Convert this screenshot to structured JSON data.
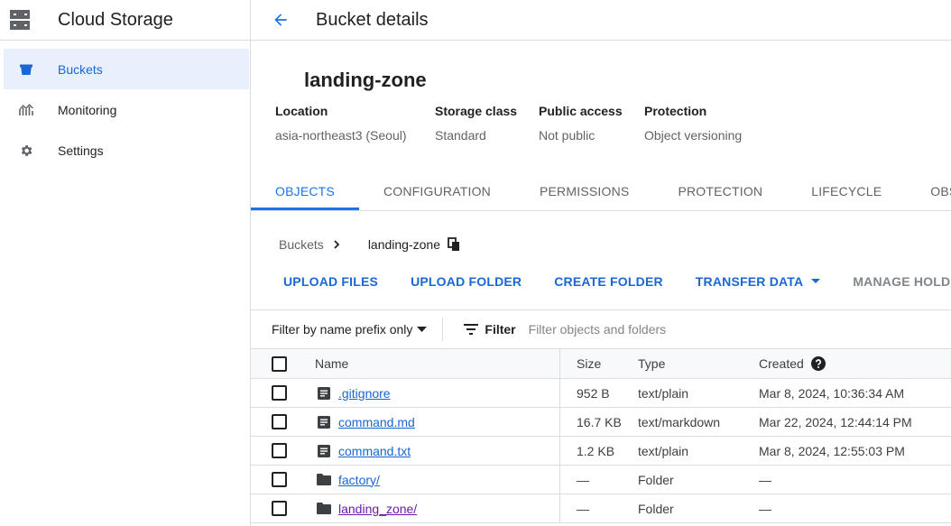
{
  "app": {
    "title": "Cloud Storage",
    "icon": "storage-icon"
  },
  "sidebar": {
    "items": [
      {
        "label": "Buckets",
        "icon": "bucket-icon",
        "active": true
      },
      {
        "label": "Monitoring",
        "icon": "monitoring-chart-icon",
        "active": false
      },
      {
        "label": "Settings",
        "icon": "gear-icon",
        "active": false
      }
    ]
  },
  "header": {
    "back_icon": "arrow-back-icon",
    "title": "Bucket details"
  },
  "bucket": {
    "name": "landing-zone",
    "properties": [
      {
        "label": "Location",
        "value": "asia-northeast3 (Seoul)"
      },
      {
        "label": "Storage class",
        "value": "Standard"
      },
      {
        "label": "Public access",
        "value": "Not public"
      },
      {
        "label": "Protection",
        "value": "Object versioning"
      }
    ]
  },
  "tabs": [
    {
      "label": "OBJECTS",
      "active": true
    },
    {
      "label": "CONFIGURATION",
      "active": false
    },
    {
      "label": "PERMISSIONS",
      "active": false
    },
    {
      "label": "PROTECTION",
      "active": false
    },
    {
      "label": "LIFECYCLE",
      "active": false
    },
    {
      "label": "OBSERV",
      "active": false
    }
  ],
  "breadcrumb": {
    "root": "Buckets",
    "current": "landing-zone",
    "separator_icon": "chevron-right-icon",
    "copy_icon": "copy-icon"
  },
  "actions": {
    "upload_files": "UPLOAD FILES",
    "upload_folder": "UPLOAD FOLDER",
    "create_folder": "CREATE FOLDER",
    "transfer_data": "TRANSFER DATA",
    "manage_holds": "MANAGE HOLDS"
  },
  "filter": {
    "mode": "Filter by name prefix only",
    "label": "Filter",
    "placeholder": "Filter objects and folders",
    "value": ""
  },
  "table": {
    "columns": {
      "name": "Name",
      "size": "Size",
      "type": "Type",
      "created": "Created"
    },
    "rows": [
      {
        "name": ".gitignore",
        "kind": "file",
        "size": "952 B",
        "type": "text/plain",
        "created": "Mar 8, 2024, 10:36:34 AM",
        "visited": false
      },
      {
        "name": "command.md",
        "kind": "file",
        "size": "16.7 KB",
        "type": "text/markdown",
        "created": "Mar 22, 2024, 12:44:14 PM",
        "visited": false
      },
      {
        "name": "command.txt",
        "kind": "file",
        "size": "1.2 KB",
        "type": "text/plain",
        "created": "Mar 8, 2024, 12:55:03 PM",
        "visited": false
      },
      {
        "name": "factory/",
        "kind": "folder",
        "size": "—",
        "type": "Folder",
        "created": "—",
        "visited": false
      },
      {
        "name": "landing_zone/",
        "kind": "folder",
        "size": "—",
        "type": "Folder",
        "created": "—",
        "visited": true
      }
    ]
  },
  "colors": {
    "accent": "#1a73e8",
    "link": "#1967d2",
    "visited_link": "#681da8",
    "active_nav_bg": "#e8f0fe",
    "border": "#dadce0",
    "icon": "#5f6368"
  }
}
